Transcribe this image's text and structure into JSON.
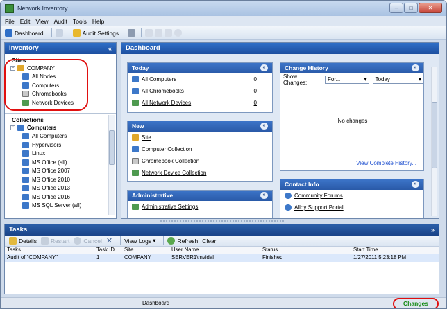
{
  "window": {
    "title": "Network Inventory",
    "min": "–",
    "max": "□",
    "close": "✕"
  },
  "menu": [
    "File",
    "Edit",
    "View",
    "Audit",
    "Tools",
    "Help"
  ],
  "toolbar": {
    "dashboard": "Dashboard",
    "audit_settings": "Audit Settings..."
  },
  "inventory": {
    "title": "Inventory",
    "collapse": "«",
    "sites_label": "Sites",
    "company": "COMPANY",
    "site_items": [
      "All Nodes",
      "Computers",
      "Chromebooks",
      "Network Devices"
    ],
    "collections_label": "Collections",
    "computers": "Computers",
    "collection_items": [
      "All Computers",
      "Hypervisors",
      "Linux",
      "MS Office (all)",
      "MS Office 2007",
      "MS Office 2010",
      "MS Office 2013",
      "MS Office 2016",
      "MS SQL Server (all)"
    ]
  },
  "dashboard": {
    "title": "Dashboard",
    "today": {
      "title": "Today",
      "rows": [
        {
          "label": "All Computers",
          "count": "0"
        },
        {
          "label": "All Chromebooks",
          "count": "0"
        },
        {
          "label": "All Network Devices",
          "count": "0"
        }
      ]
    },
    "new": {
      "title": "New",
      "items": [
        "Site",
        "Computer Collection",
        "Chromebook Collection",
        "Network Device Collection"
      ]
    },
    "administrative": {
      "title": "Administrative",
      "items": [
        "Administrative Settings"
      ]
    },
    "history": {
      "title": "Change History",
      "show_label": "Show Changes:",
      "filter": "For...",
      "period": "Today",
      "empty": "No changes",
      "link": "View Complete History..."
    },
    "contact": {
      "title": "Contact Info",
      "items": [
        "Community Forums",
        "Alloy Support Portal"
      ]
    }
  },
  "tasks": {
    "title": "Tasks",
    "toolbar": [
      "Details",
      "Restart",
      "Cancel",
      "View Logs",
      "Refresh",
      "Clear"
    ],
    "columns": [
      "Tasks",
      "Task ID",
      "Site",
      "User Name",
      "Status",
      "Start Time"
    ],
    "rows": [
      [
        "Audit of \"COMPANY\"",
        "1",
        "COMPANY",
        "SERVER1\\mvidal",
        "Finished",
        "1/27/2011 5:23:18 PM"
      ]
    ]
  },
  "status": {
    "center": "Dashboard",
    "changes": "Changes"
  }
}
